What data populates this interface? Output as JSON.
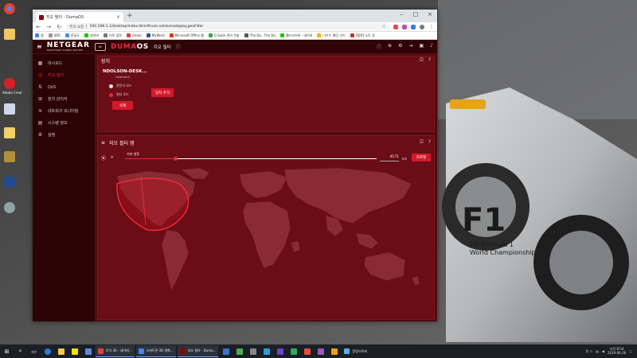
{
  "browser": {
    "tab_title": "지오 필터 - DumaOS",
    "address_prefix": "주의 요함",
    "url": "192.168.1.1/desktop/index.html#com.netdumadeploy.geoFilter",
    "bookmarks": [
      "앱",
      "SDS",
      "한글도",
      "네이버",
      "다른 검정",
      "Gmail",
      "MyWord",
      "Microsoft Office 웹",
      "G Suite 관리 콘솔",
      "The Do...The Do",
      "웹드라이버 - 네이버",
      "나우드 메인 가기",
      "[텔렉] 노트 정"
    ]
  },
  "app": {
    "brand": "NETGEAR",
    "brand_sub": "NIGHTHAWK GAMING ROUTER",
    "os_prefix": "DUMA",
    "os_suffix": "OS",
    "page_title": "지오 필터",
    "sidebar": [
      {
        "label": "대시보드",
        "icon": "dashboard-icon"
      },
      {
        "label": "지오 필터",
        "icon": "geo-filter-icon",
        "active": true
      },
      {
        "label": "QoS",
        "icon": "qos-icon"
      },
      {
        "label": "장치 관리자",
        "icon": "device-manager-icon"
      },
      {
        "label": "네트워크 모니터링",
        "icon": "network-monitor-icon"
      },
      {
        "label": "시스템 정보",
        "icon": "system-info-icon"
      },
      {
        "label": "설정",
        "icon": "settings-icon"
      }
    ],
    "devices_panel": {
      "title": "장치",
      "device_name": "NDOLSON-DESK...",
      "device_sub": "Geomatch",
      "mode_spectate": "관전자 모드",
      "mode_filter": "필터 모드",
      "delete_label": "삭제",
      "add_device_label": "장치 추가"
    },
    "geo_panel": {
      "title": "지오 필터 맵",
      "distance_label": "거리 설정",
      "distance_value": "4171",
      "distance_unit": "km",
      "distance_fraction": 0.2,
      "profile_label": "프로필"
    }
  },
  "taskbar": {
    "apps": [
      "토익 30 - 네이버...",
      "스마트폰 3D 영화...",
      "지오 필터 - Duma..."
    ],
    "tray_text": "한 ㅁ ",
    "time": "오전 8:54",
    "date": "2019-06-28",
    "extra_app": "알림으로써"
  },
  "desktop_icons": [
    "Adobe Creat...",
    "",
    "",
    "",
    "",
    ""
  ],
  "colors": {
    "accent": "#e42b3a",
    "app_bg": "#520a11",
    "sidebar_bg": "#2b0305"
  }
}
